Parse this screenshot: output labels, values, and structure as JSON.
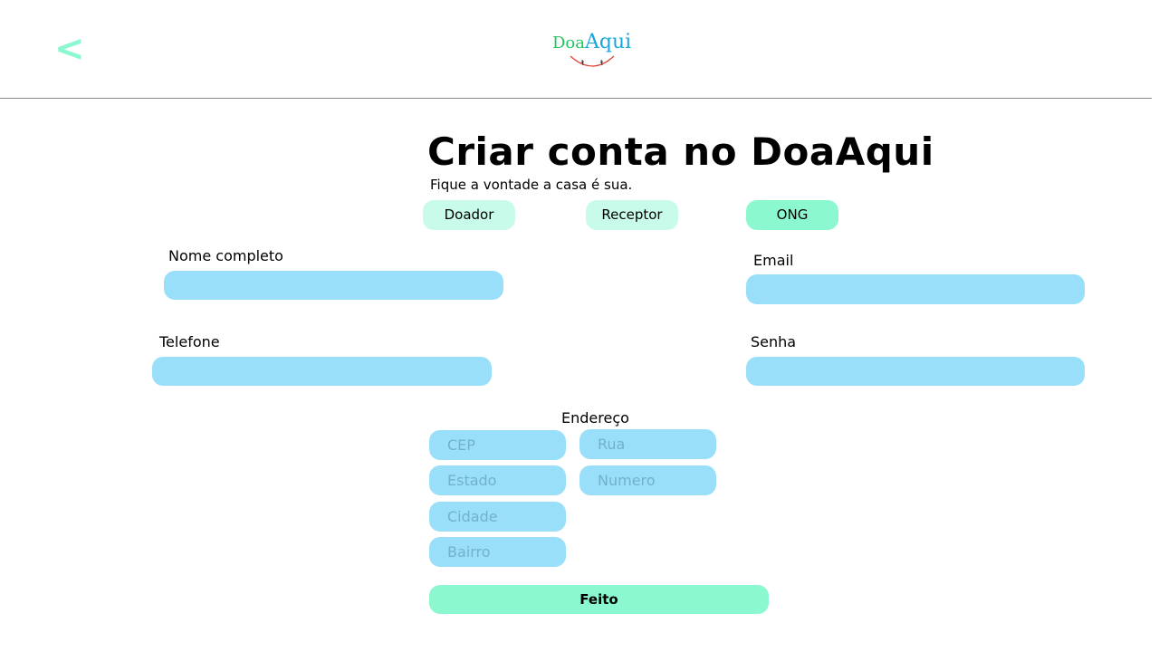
{
  "header": {
    "back_label": "<",
    "logo": {
      "part1": "Doa",
      "part2": "Aqui"
    }
  },
  "page": {
    "title": "Criar conta no DoaAqui",
    "subtitle": "Fique a vontade a casa é sua."
  },
  "roles": [
    {
      "label": "Doador"
    },
    {
      "label": "Receptor"
    },
    {
      "label": "ONG"
    }
  ],
  "form": {
    "nome": {
      "label": "Nome completo",
      "value": "",
      "placeholder": ""
    },
    "email": {
      "label": "Email",
      "value": "",
      "placeholder": ""
    },
    "telefone": {
      "label": "Telefone",
      "value": "",
      "placeholder": ""
    },
    "senha": {
      "label": "Senha",
      "value": "",
      "placeholder": ""
    },
    "endereco": {
      "label": "Endereço",
      "cep": {
        "placeholder": "CEP"
      },
      "rua": {
        "placeholder": "Rua"
      },
      "estado": {
        "placeholder": "Estado"
      },
      "numero": {
        "placeholder": "Numero"
      },
      "cidade": {
        "placeholder": "Cidade"
      },
      "bairro": {
        "placeholder": "Bairro"
      }
    },
    "submit_label": "Feito"
  },
  "colors": {
    "accent": "#8cf8d0",
    "accent_light": "#c8fbe9",
    "input_bg": "#9adffa",
    "logo_green": "#22c55e",
    "logo_blue": "#1aa7d9"
  },
  "icons": {
    "back": "chevron-left-icon"
  }
}
